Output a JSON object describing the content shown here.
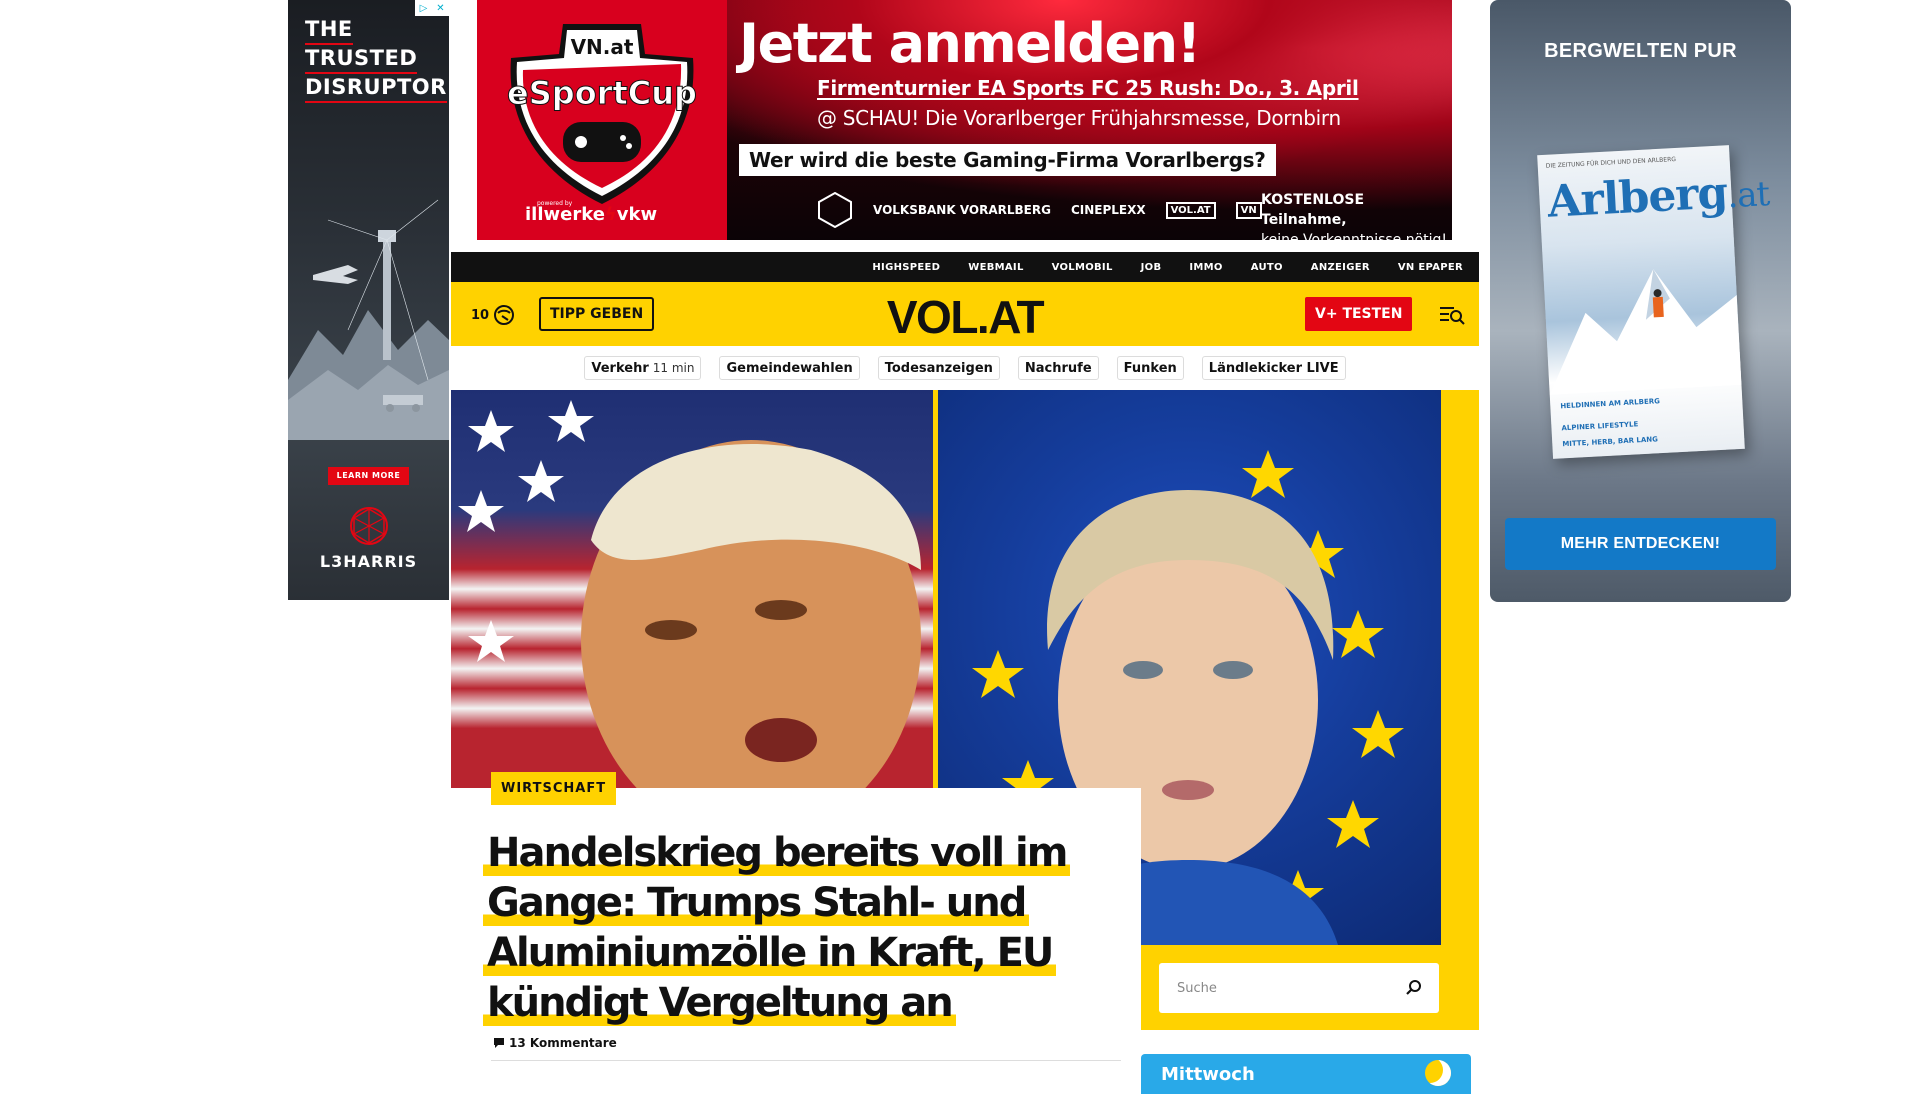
{
  "ad_left": {
    "title_lines": [
      "THE",
      "TRUSTED",
      "DISRUPTOR"
    ],
    "corner_icons": [
      "adchoices-icon",
      "close-icon"
    ],
    "cta": "LEARN MORE",
    "brand": "L3HARRIS"
  },
  "ad_right": {
    "title": "BERGWELTEN PUR",
    "magazine_top": "DIE ZEITUNG FÜR DICH UND DEN ARLBERG",
    "magazine_title": "Arlberg",
    "magazine_title_suffix": ".at",
    "magazine_line1": "HELDINNEN AM ARLBERG",
    "magazine_line2": "ALPINER LIFESTYLE",
    "magazine_line3": "MITTE, HERB, BAR LANG",
    "cta": "MEHR ENTDECKEN!"
  },
  "banner": {
    "shield_top": "VN.at",
    "shield_title": "eSportCup",
    "powered_by": "powered by",
    "powered_brand_a": "illwerke",
    "powered_brand_b": "vkw",
    "headline": "Jetzt anmelden!",
    "line1": "Firmenturnier EA Sports FC 25 Rush: Do., 3. April",
    "line2": "@ SCHAU! Die Vorarlberger Frühjahrsmesse, Dornbirn",
    "question": "Wer wird die beste Gaming-Firma Vorarlbergs?",
    "sponsors": [
      "VOLKSBANK VORARLBERG",
      "CINEPLEXX",
      "VOL.AT",
      "VN"
    ],
    "free_line1": "KOSTENLOSE Teilnahme,",
    "free_line2": "keine Vorkenntnisse nötig!"
  },
  "topbar": {
    "links": [
      "HIGHSPEED",
      "WEBMAIL",
      "VOLMOBIL",
      "JOB",
      "IMMO",
      "AUTO",
      "ANZEIGER",
      "VN EPAPER"
    ]
  },
  "header": {
    "temperature": "10",
    "weather_icon": "weather-sun-icon",
    "tipp_label": "TIPP GEBEN",
    "logo": "VOL.AT",
    "vplus_label": "V+ TESTEN",
    "menu_icon": "menu-search-icon"
  },
  "chips": [
    {
      "label": "Verkehr",
      "extra": "11 min"
    },
    {
      "label": "Gemeindewahlen",
      "extra": ""
    },
    {
      "label": "Todesanzeigen",
      "extra": ""
    },
    {
      "label": "Nachrufe",
      "extra": ""
    },
    {
      "label": "Funken",
      "extra": ""
    },
    {
      "label": "Ländlekicker LIVE",
      "extra": ""
    }
  ],
  "hero": {
    "category": "WIRTSCHAFT",
    "headline": "Handelskrieg bereits voll im Gange: Trumps Stahl- und Aluminiumzölle in Kraft, EU kündigt Vergeltung an",
    "comments": "13 Kommentare"
  },
  "search": {
    "placeholder": "Suche"
  },
  "daycard": {
    "label": "Mittwoch"
  },
  "colors": {
    "brand_yellow": "#ffd200",
    "accent_red": "#e30613",
    "topbar": "#111111",
    "ad_blue": "#1379c7"
  }
}
